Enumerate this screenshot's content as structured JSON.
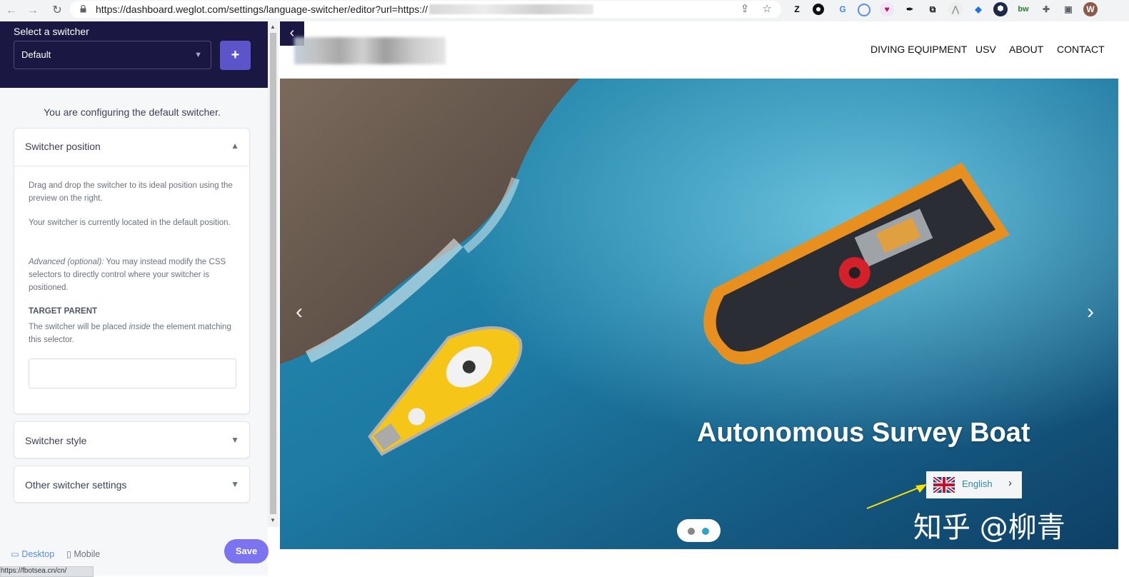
{
  "browser": {
    "url": "https://dashboard.weglot.com/settings/language-switcher/editor?url=https://",
    "profile_initial": "W",
    "ext_z_label": "Z",
    "ext_bw_label": "bw"
  },
  "sidebar": {
    "select_label": "Select a switcher",
    "selected_switcher": "Default",
    "config_text": "You are configuring the default switcher.",
    "position_card": {
      "title": "Switcher position",
      "p1": "Drag and drop the switcher to its ideal position using the preview on the right.",
      "p2": "Your switcher is currently located in the default position.",
      "p3_em": "Advanced (optional):",
      "p3_rest": " You may instead modify the CSS selectors to directly control where your switcher is positioned.",
      "target_label": "TARGET PARENT",
      "p4_a": "The switcher will be placed ",
      "p4_em": "inside",
      "p4_b": " the element matching this selector.",
      "target_value": ""
    },
    "style_card_title": "Switcher style",
    "other_card_title": "Other switcher settings",
    "devices": {
      "desktop": "Desktop",
      "mobile": "Mobile"
    },
    "save_label": "Save",
    "status_tip": "https://fbotsea.cn/cn/"
  },
  "preview": {
    "nav": [
      "DIVING EQUIPMENT",
      "USV",
      "ABOUT",
      "CONTACT"
    ],
    "hero_title": "Autonomous Survey Boat",
    "language": "English",
    "watermark": "知乎 @柳青"
  },
  "colors": {
    "panel_dark": "#1a1842",
    "accent": "#5b55c9",
    "save": "#7b73f0",
    "ocean": "#1a5f8c",
    "boat_orange": "#e8901f",
    "boat_yellow": "#f5c518"
  }
}
